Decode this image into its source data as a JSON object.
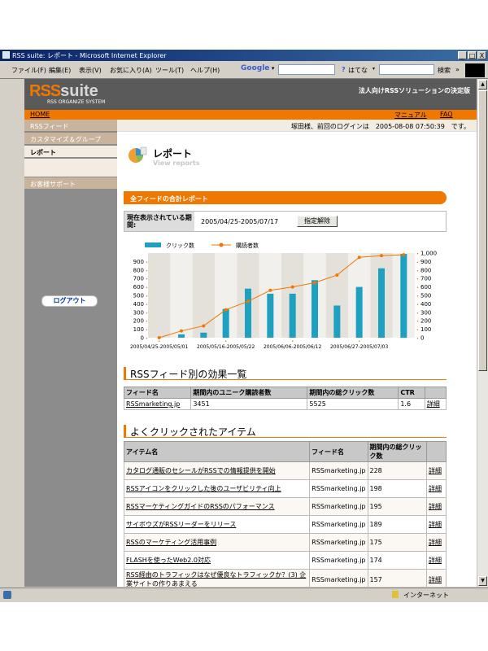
{
  "window": {
    "title": "RSS suite: レポート - Microsoft Internet Explorer",
    "min": "_",
    "max": "□",
    "close": "X"
  },
  "menu": [
    "ファイル(F)",
    "編集(E)",
    "表示(V)",
    "お気に入り(A)",
    "ツール(T)",
    "ヘルプ(H)"
  ],
  "toolbar": {
    "google": "Google",
    "hatena": "はてな",
    "search": "検索",
    "chevron": "»"
  },
  "header": {
    "logo_mark": "RSS",
    "logo_suite": "suite",
    "logo_sub": "RSS ORGANIZE SYSTEM",
    "tagline": "法人向けRSSソリューションの決定版"
  },
  "nav": {
    "home": "HOME",
    "manual": "マニュアル",
    "faq": "FAQ"
  },
  "sidebar": {
    "items": [
      "RSSフィード",
      "カスタマイズ＆グループ",
      "レポート"
    ],
    "support": "お客様サポート",
    "logout": "ログアウト"
  },
  "userbar": {
    "text": "塚田様、前回のログインは　2005-08-08 07:50:39　です。"
  },
  "page": {
    "title": "レポート",
    "title_en": "View reports",
    "section": "全フィードの合計レポート",
    "period_label": "現在表示されている期間:",
    "period_value": "2005/04/25-2005/07/17",
    "period_button": "指定解除"
  },
  "chart_data": {
    "type": "bar",
    "legend": [
      "クリック数",
      "購読者数"
    ],
    "x": [
      "2005/04/25-2005/05/01",
      "",
      "",
      "2005/05/16-2005/05/22",
      "",
      "",
      "2005/06/06-2005/06/12",
      "",
      "",
      "2005/06/27-2005/07/03",
      "",
      ""
    ],
    "series": [
      {
        "name": "クリック数",
        "type": "bar",
        "values": [
          0,
          40,
          60,
          340,
          580,
          520,
          520,
          680,
          380,
          600,
          820,
          990
        ]
      },
      {
        "name": "購読者数",
        "type": "line",
        "values": [
          0,
          80,
          140,
          330,
          430,
          560,
          600,
          650,
          740,
          950,
          970,
          980
        ]
      }
    ],
    "y_left": {
      "min": 0,
      "max": 900,
      "ticks": [
        "900",
        "800",
        "700",
        "600",
        "500",
        "400",
        "300",
        "200",
        "100",
        "0"
      ]
    },
    "y_right": {
      "min": 0,
      "max": 1000,
      "ticks": [
        "1,000",
        "900",
        "800",
        "700",
        "600",
        "500",
        "400",
        "300",
        "200",
        "100",
        "0"
      ]
    },
    "colors": {
      "bar": "#1ea0c0",
      "line": "#f07800"
    }
  },
  "effects": {
    "heading": "RSSフィード別の効果一覧",
    "columns": [
      "フィード名",
      "期間内のユニーク購読者数",
      "期間内の総クリック数",
      "CTR",
      ""
    ],
    "rows": [
      [
        "RSSmarketing.jp",
        "3451",
        "5525",
        "1.6",
        "詳細"
      ]
    ]
  },
  "items": {
    "heading": "よくクリックされたアイテム",
    "columns": [
      "アイテム名",
      "フィード名",
      "期間内の総クリック数",
      ""
    ],
    "rows": [
      [
        "カタログ通販のセシールがRSSでの情報提供を開始",
        "RSSmarketing.jp",
        "228",
        "詳細"
      ],
      [
        "RSSアイコンをクリックした後のユーザビリティ向上",
        "RSSmarketing.jp",
        "198",
        "詳細"
      ],
      [
        "RSSマーケティングガイドのRSSのパフォーマンス",
        "RSSmarketing.jp",
        "195",
        "詳細"
      ],
      [
        "サイボウズがRSSリーダーをリリース",
        "RSSmarketing.jp",
        "189",
        "詳細"
      ],
      [
        "RSSのマーケティング活用事例",
        "RSSmarketing.jp",
        "175",
        "詳細"
      ],
      [
        "FLASHを使ったWeb2.0対応",
        "RSSmarketing.jp",
        "174",
        "詳細"
      ],
      [
        "RSS経由のトラフィックはなぜ優良なトラフィックか？(3) 企業サイトの作りあまえる",
        "RSSmarketing.jp",
        "157",
        "詳細"
      ]
    ]
  },
  "status": {
    "zone": "インターネット"
  }
}
